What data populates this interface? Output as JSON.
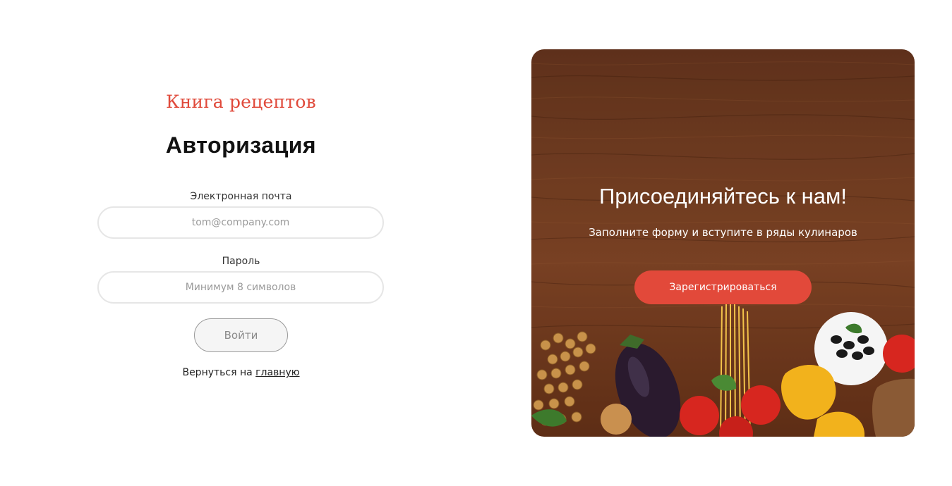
{
  "brand": "Книга рецептов",
  "auth": {
    "title": "Авторизация",
    "email_label": "Электронная почта",
    "email_placeholder": "tom@company.com",
    "password_label": "Пароль",
    "password_placeholder": "Минимум 8 символов",
    "login_button": "Войти",
    "back_prefix": "Вернуться на ",
    "back_link": "главную"
  },
  "promo": {
    "title": "Присоединяйтесь к нам!",
    "subtitle": "Заполните форму и вступите в ряды кулинаров",
    "register_button": "Зарегистрироваться",
    "image": "wooden-table-with-vegetables-image"
  },
  "colors": {
    "accent": "#e2493a",
    "brand": "#e04a3b"
  }
}
